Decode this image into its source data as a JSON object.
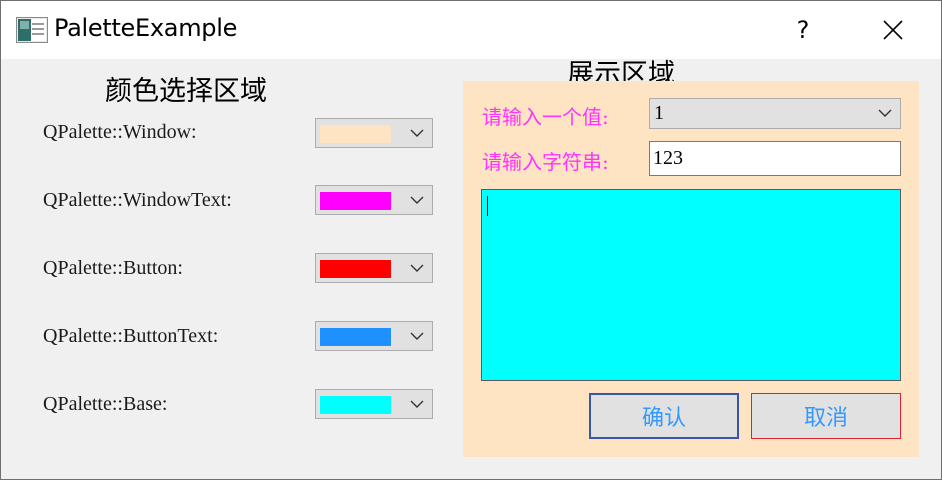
{
  "window": {
    "title": "PaletteExample",
    "help_label": "?"
  },
  "left": {
    "title": "颜色选择区域",
    "rows": [
      {
        "label": "QPalette::Window:",
        "color": "#ffe4c4"
      },
      {
        "label": "QPalette::WindowText:",
        "color": "#ff00ff"
      },
      {
        "label": "QPalette::Button:",
        "color": "#ff0000"
      },
      {
        "label": "QPalette::ButtonText:",
        "color": "#1e90ff"
      },
      {
        "label": "QPalette::Base:",
        "color": "#00ffff"
      }
    ]
  },
  "right": {
    "title": "展示区域",
    "value_label": "请输入一个值:",
    "value_selected": "1",
    "string_label": "请输入字符串:",
    "string_value": "123",
    "ok_label": "确认",
    "cancel_label": "取消"
  },
  "colors": {
    "panel_background": "#ffe4c4",
    "label_text": "#ff33ff",
    "button_text": "#3399ff",
    "base": "#00ffff"
  }
}
